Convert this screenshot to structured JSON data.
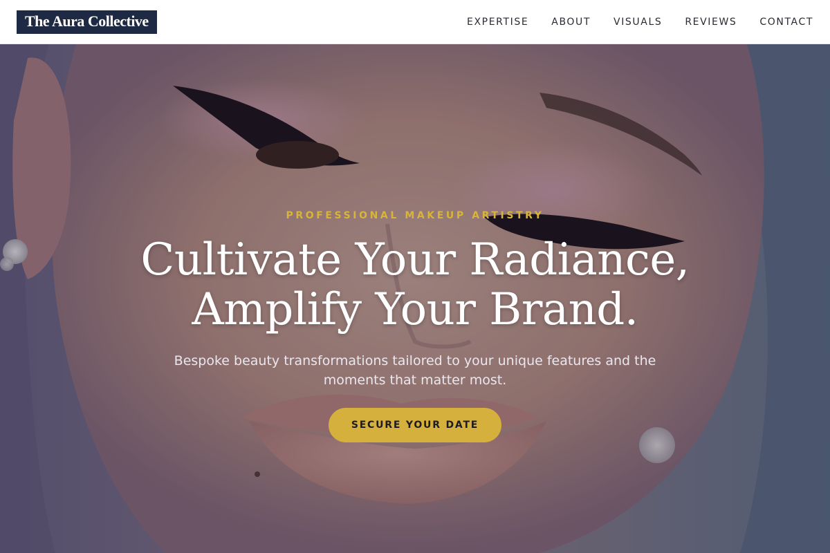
{
  "brand": {
    "logo_text": "The Aura Collective"
  },
  "nav": {
    "items": [
      {
        "label": "EXPERTISE"
      },
      {
        "label": "ABOUT"
      },
      {
        "label": "VISUALS"
      },
      {
        "label": "REVIEWS"
      },
      {
        "label": "CONTACT"
      }
    ]
  },
  "hero": {
    "eyebrow": "PROFESSIONAL MAKEUP ARTISTRY",
    "headline_line1": "Cultivate Your Radiance,",
    "headline_line2": "Amplify Your Brand.",
    "subhead": "Bespoke beauty transformations tailored to your unique features and the moments that matter most.",
    "cta_label": "SECURE YOUR DATE"
  },
  "colors": {
    "logo_bg": "#1e2a44",
    "accent_gold": "#d6b03c",
    "nav_text": "#2a2a33",
    "hero_text": "#ffffff"
  }
}
